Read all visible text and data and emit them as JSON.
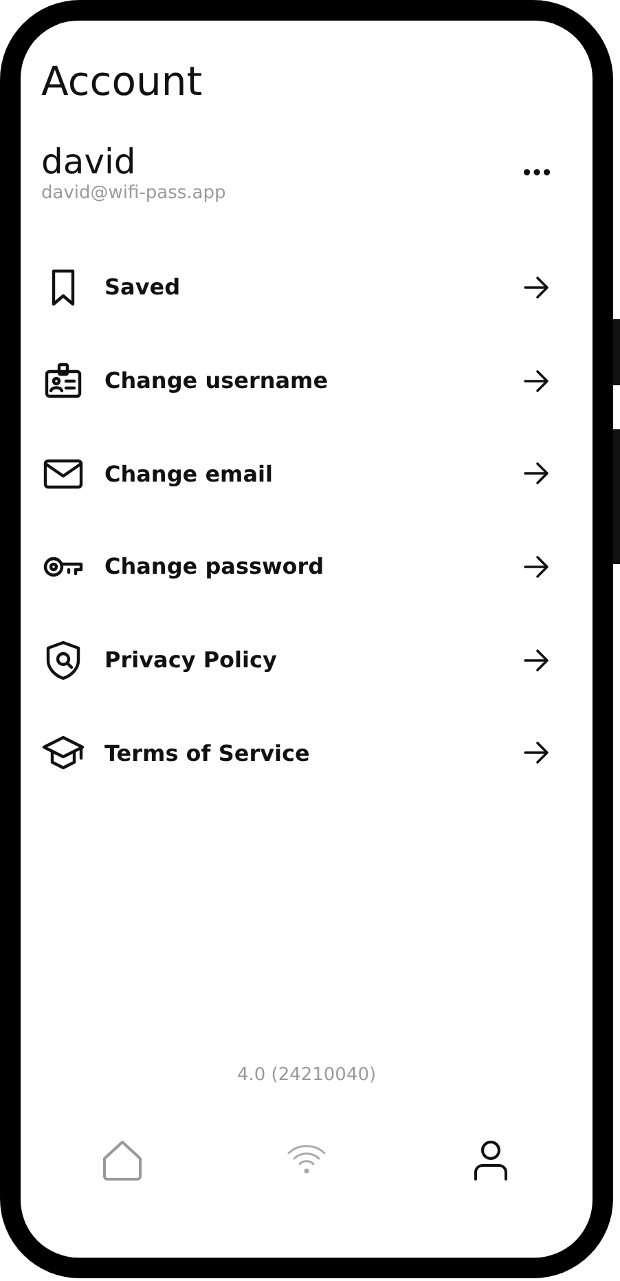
{
  "header": {
    "title": "Account"
  },
  "profile": {
    "name": "david",
    "email": "david@wifi-pass.app",
    "menu_icon": "•••"
  },
  "menu": [
    {
      "kind": "bookmark",
      "label": "Saved"
    },
    {
      "kind": "badge",
      "label": "Change username"
    },
    {
      "kind": "mail",
      "label": "Change email"
    },
    {
      "kind": "key",
      "label": "Change password"
    },
    {
      "kind": "shield",
      "label": "Privacy Policy"
    },
    {
      "kind": "cap",
      "label": "Terms of Service"
    }
  ],
  "version": "4.0 (24210040)",
  "nav": [
    {
      "kind": "home",
      "selected": false
    },
    {
      "kind": "wifi",
      "selected": false
    },
    {
      "kind": "user",
      "selected": true
    }
  ]
}
